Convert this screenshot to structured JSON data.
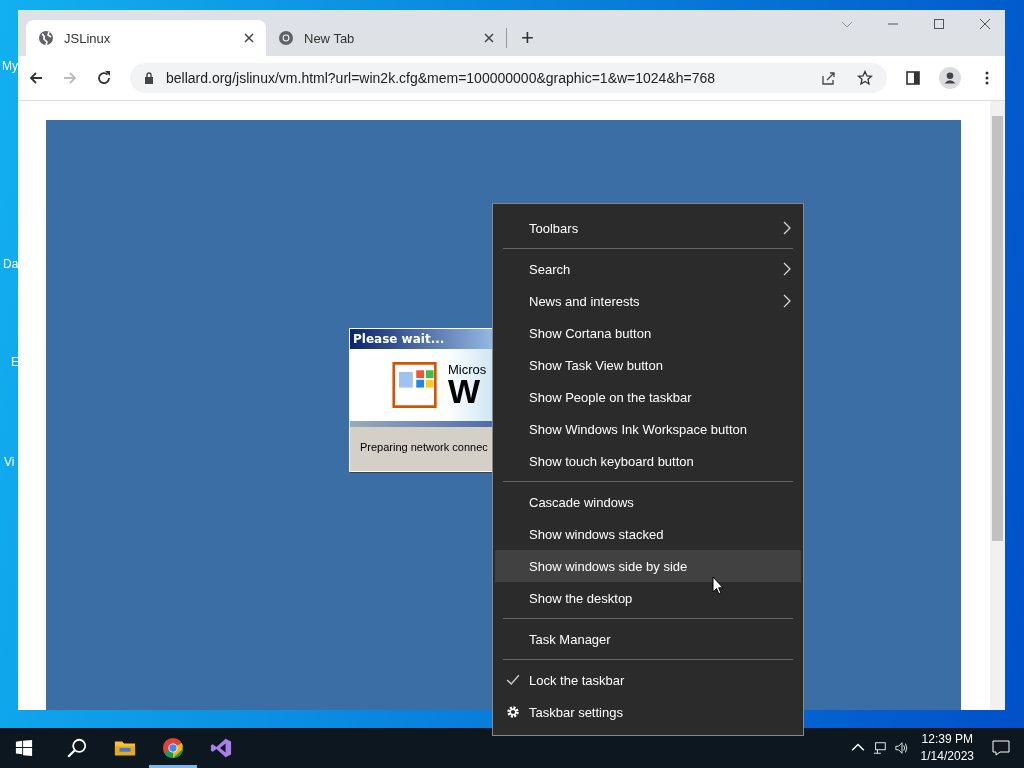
{
  "desktop_icons": [
    {
      "label": "My"
    },
    {
      "label": "Da"
    },
    {
      "label": "E"
    },
    {
      "label": "Vi"
    }
  ],
  "browser": {
    "tabs": [
      {
        "title": "JSLinux",
        "selected": true,
        "kind": "globe"
      },
      {
        "title": "New Tab",
        "selected": false,
        "kind": "chrome"
      }
    ],
    "new_tab": "+",
    "url": "bellard.org/jslinux/vm.html?url=win2k.cfg&mem=100000000&graphic=1&w=1024&h=768"
  },
  "vm_dialog": {
    "title": "Please wait...",
    "banner_text": "Micros",
    "banner_letter": "W",
    "status": "Preparing network connec"
  },
  "context_menu": {
    "items": [
      {
        "kind": "item",
        "label": "Toolbars",
        "submenu": true,
        "checked": false,
        "highlighted": false
      },
      {
        "kind": "separator"
      },
      {
        "kind": "item",
        "label": "Search",
        "submenu": true,
        "checked": false,
        "highlighted": false
      },
      {
        "kind": "item",
        "label": "News and interests",
        "submenu": true,
        "checked": false,
        "highlighted": false
      },
      {
        "kind": "item",
        "label": "Show Cortana button",
        "submenu": false,
        "checked": false,
        "highlighted": false
      },
      {
        "kind": "item",
        "label": "Show Task View button",
        "submenu": false,
        "checked": false,
        "highlighted": false
      },
      {
        "kind": "item",
        "label": "Show People on the taskbar",
        "submenu": false,
        "checked": false,
        "highlighted": false
      },
      {
        "kind": "item",
        "label": "Show Windows Ink Workspace button",
        "submenu": false,
        "checked": false,
        "highlighted": false
      },
      {
        "kind": "item",
        "label": "Show touch keyboard button",
        "submenu": false,
        "checked": false,
        "highlighted": false
      },
      {
        "kind": "separator"
      },
      {
        "kind": "item",
        "label": "Cascade windows",
        "submenu": false,
        "checked": false,
        "highlighted": false
      },
      {
        "kind": "item",
        "label": "Show windows stacked",
        "submenu": false,
        "checked": false,
        "highlighted": false
      },
      {
        "kind": "item",
        "label": "Show windows side by side",
        "submenu": false,
        "checked": false,
        "highlighted": true
      },
      {
        "kind": "item",
        "label": "Show the desktop",
        "submenu": false,
        "checked": false,
        "highlighted": false
      },
      {
        "kind": "separator"
      },
      {
        "kind": "item",
        "label": "Task Manager",
        "submenu": false,
        "checked": false,
        "highlighted": false
      },
      {
        "kind": "separator"
      },
      {
        "kind": "item",
        "label": "Lock the taskbar",
        "submenu": false,
        "checked": true,
        "highlighted": false
      },
      {
        "kind": "settings",
        "label": "Taskbar settings",
        "submenu": false,
        "checked": false,
        "highlighted": false
      }
    ]
  },
  "taskbar": {
    "apps": [
      {
        "kind": "folder",
        "active": false
      },
      {
        "kind": "chrome",
        "active": true
      },
      {
        "kind": "studio",
        "active": false
      }
    ],
    "time": "12:39 PM",
    "date": "1/14/2023"
  }
}
